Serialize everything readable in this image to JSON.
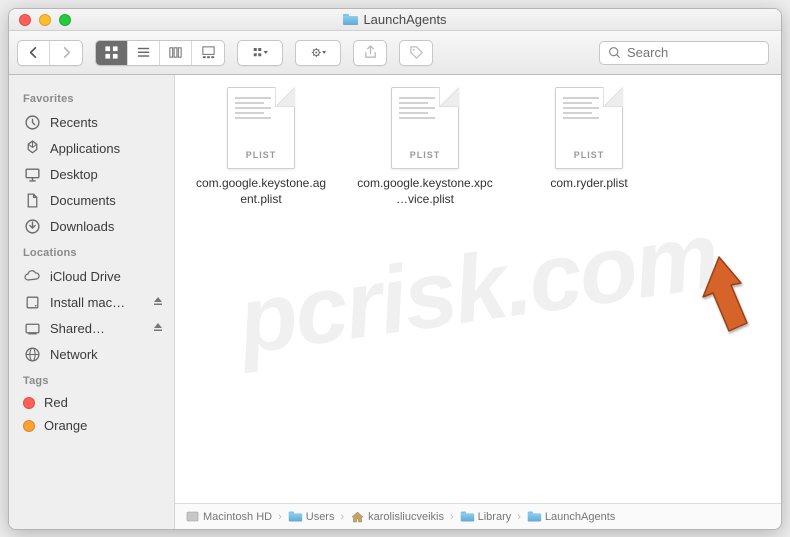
{
  "window": {
    "title": "LaunchAgents"
  },
  "search": {
    "placeholder": "Search"
  },
  "sidebar": {
    "sections": [
      {
        "heading": "Favorites",
        "items": [
          {
            "label": "Recents",
            "icon": "clock-icon"
          },
          {
            "label": "Applications",
            "icon": "apps-icon"
          },
          {
            "label": "Desktop",
            "icon": "desktop-icon"
          },
          {
            "label": "Documents",
            "icon": "documents-icon"
          },
          {
            "label": "Downloads",
            "icon": "downloads-icon"
          }
        ]
      },
      {
        "heading": "Locations",
        "items": [
          {
            "label": "iCloud Drive",
            "icon": "icloud-icon"
          },
          {
            "label": "Install mac…",
            "icon": "disk-icon",
            "eject": true
          },
          {
            "label": "Shared…",
            "icon": "shared-icon",
            "eject": true
          },
          {
            "label": "Network",
            "icon": "network-icon"
          }
        ]
      },
      {
        "heading": "Tags",
        "items": [
          {
            "label": "Red",
            "tag_color": "red"
          },
          {
            "label": "Orange",
            "tag_color": "orange"
          }
        ]
      }
    ]
  },
  "files": {
    "badge": "PLIST",
    "items": [
      {
        "name": "com.google.keystone.agent.plist"
      },
      {
        "name": "com.google.keystone.xpc…vice.plist"
      },
      {
        "name": "com.ryder.plist"
      }
    ]
  },
  "pathbar": {
    "items": [
      {
        "label": "Macintosh HD",
        "icon": "disk"
      },
      {
        "label": "Users",
        "icon": "folder"
      },
      {
        "label": "karolisliucveikis",
        "icon": "home"
      },
      {
        "label": "Library",
        "icon": "folder"
      },
      {
        "label": "LaunchAgents",
        "icon": "folder"
      }
    ]
  },
  "annotation": {
    "arrow_color": "#d5632c"
  },
  "watermark": "pcrisk.com"
}
